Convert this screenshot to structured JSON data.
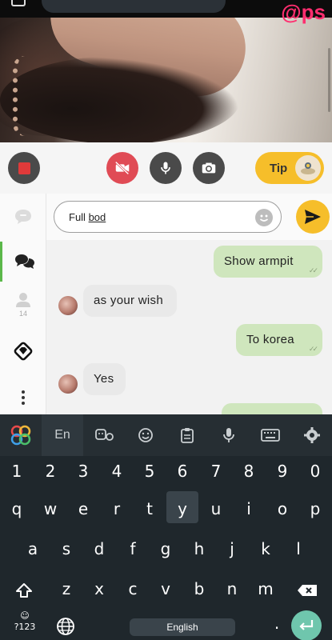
{
  "video": {
    "handle": "@ps"
  },
  "controls": {
    "stop": "stop-record",
    "camera": "camera-off",
    "mic": "microphone",
    "flip": "flip-camera",
    "tip_label": "Tip"
  },
  "sidebar": {
    "items": [
      {
        "icon": "chat-outline-icon"
      },
      {
        "icon": "chat-bubbles-icon"
      },
      {
        "icon": "user-icon",
        "count": "14"
      },
      {
        "icon": "diamond-icon"
      },
      {
        "icon": "more-vertical-icon"
      }
    ]
  },
  "chat": {
    "input_value": "Full bod",
    "input_value_plain": "Full ",
    "input_value_underlined": "bod",
    "messages": [
      {
        "text": "Show armpit",
        "direction": "out"
      },
      {
        "text": "as your wish",
        "direction": "in"
      },
      {
        "text": "To korea",
        "direction": "out"
      },
      {
        "text": "Yes",
        "direction": "in"
      }
    ]
  },
  "keyboard": {
    "toolbar": [
      "apps-icon",
      "En",
      "stickers-icon",
      "emoji-icon",
      "clipboard-icon",
      "mic-icon",
      "keyboard-icon",
      "settings-icon"
    ],
    "numbers": [
      "1",
      "2",
      "3",
      "4",
      "5",
      "6",
      "7",
      "8",
      "9",
      "0"
    ],
    "row1": [
      "q",
      "w",
      "e",
      "r",
      "t",
      "y",
      "u",
      "i",
      "o",
      "p"
    ],
    "row2": [
      "a",
      "s",
      "d",
      "f",
      "g",
      "h",
      "j",
      "k",
      "l"
    ],
    "row3": [
      "z",
      "x",
      "c",
      "v",
      "b",
      "n",
      "m"
    ],
    "symbols_label": "?123",
    "space_label": "English",
    "period": "."
  },
  "colors": {
    "accent": "#f6be2a",
    "outgoing": "#cfe6bd",
    "incoming": "#e9e9e9",
    "handle": "#ff2d6f",
    "enter": "#6fc6ad"
  }
}
